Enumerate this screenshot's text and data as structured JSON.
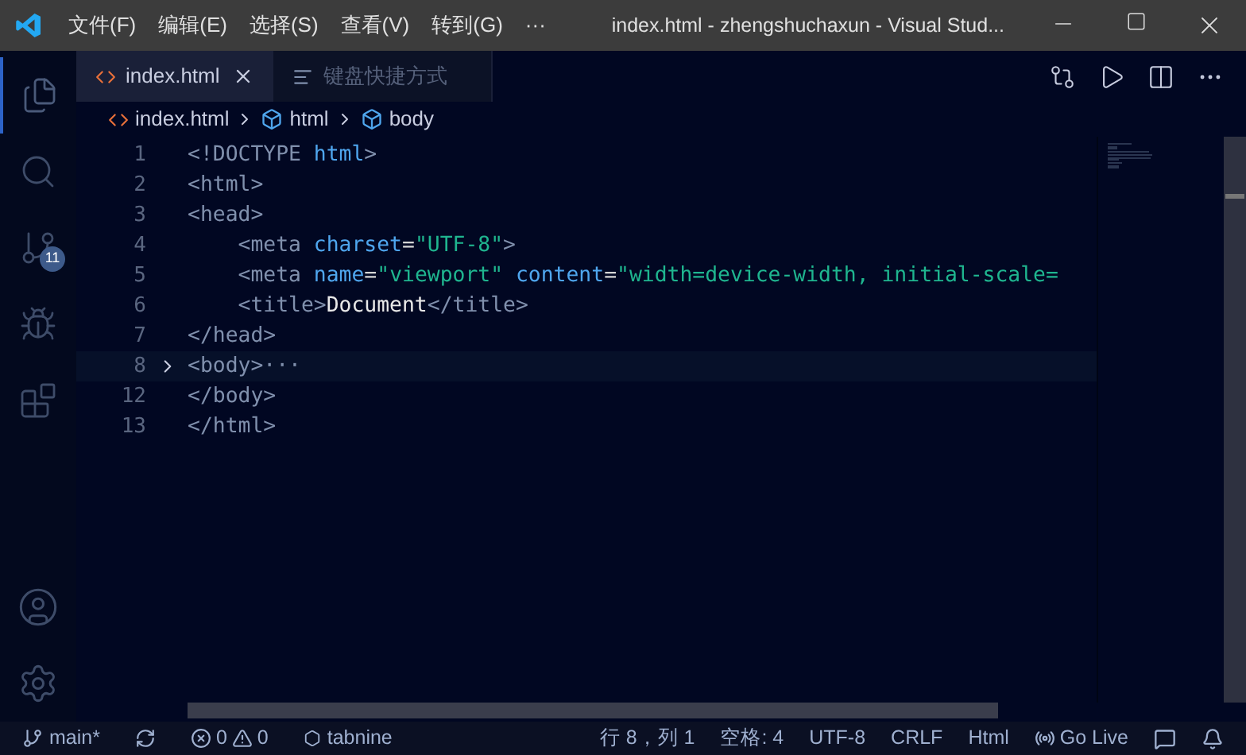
{
  "menu": [
    "文件(F)",
    "编辑(E)",
    "选择(S)",
    "查看(V)",
    "转到(G)",
    "···"
  ],
  "window": {
    "title": "index.html - zhengshuchaxun - Visual Stud..."
  },
  "activity_bar": [
    {
      "kind": "files",
      "selected": true
    },
    {
      "kind": "search",
      "selected": false
    },
    {
      "kind": "git",
      "selected": false,
      "badge": "11"
    },
    {
      "kind": "debug",
      "selected": false
    },
    {
      "kind": "extensions",
      "selected": false
    }
  ],
  "tabs": [
    {
      "label": "index.html",
      "kind": "html",
      "selected": true
    },
    {
      "label": "键盘快捷方式",
      "kind": "keys",
      "selected": false
    }
  ],
  "breadcrumbs": [
    {
      "label": "index.html",
      "kind": "file"
    },
    {
      "label": "html",
      "kind": "element"
    },
    {
      "label": "body",
      "kind": "element"
    }
  ],
  "code": [
    {
      "number": "1",
      "folded": false,
      "current": false,
      "tokens": [
        {
          "kind": "tag",
          "text": "<!DOCTYPE "
        },
        {
          "kind": "attr",
          "text": "html"
        },
        {
          "kind": "tag",
          "text": ">"
        }
      ]
    },
    {
      "number": "2",
      "folded": false,
      "current": false,
      "tokens": [
        {
          "kind": "tag",
          "text": "<html>"
        }
      ]
    },
    {
      "number": "3",
      "folded": false,
      "current": false,
      "tokens": [
        {
          "kind": "tag",
          "text": "<head>"
        }
      ]
    },
    {
      "number": "4",
      "folded": false,
      "current": false,
      "tokens": [
        {
          "kind": "tag",
          "text": "    <meta "
        },
        {
          "kind": "attr",
          "text": "charset"
        },
        {
          "kind": "punct",
          "text": "="
        },
        {
          "kind": "string",
          "text": "\"UTF-8\""
        },
        {
          "kind": "tag",
          "text": ">"
        }
      ]
    },
    {
      "number": "5",
      "folded": false,
      "current": false,
      "tokens": [
        {
          "kind": "tag",
          "text": "    <meta "
        },
        {
          "kind": "attr",
          "text": "name"
        },
        {
          "kind": "punct",
          "text": "="
        },
        {
          "kind": "string",
          "text": "\"viewport\""
        },
        {
          "kind": "attr",
          "text": " content"
        },
        {
          "kind": "punct",
          "text": "="
        },
        {
          "kind": "string",
          "text": "\"width=device-width, initial-scale="
        }
      ]
    },
    {
      "number": "6",
      "folded": false,
      "current": false,
      "tokens": [
        {
          "kind": "tag",
          "text": "    <title>"
        },
        {
          "kind": "text",
          "text": "Document"
        },
        {
          "kind": "tag",
          "text": "</title>"
        }
      ]
    },
    {
      "number": "7",
      "folded": false,
      "current": false,
      "tokens": [
        {
          "kind": "tag",
          "text": "</head>"
        }
      ]
    },
    {
      "number": "8",
      "folded": true,
      "current": true,
      "tokens": [
        {
          "kind": "tag",
          "text": "<body>"
        },
        {
          "kind": "ellipsis",
          "text": "···"
        }
      ]
    },
    {
      "number": "12",
      "folded": false,
      "current": false,
      "tokens": [
        {
          "kind": "tag",
          "text": "</body>"
        }
      ]
    },
    {
      "number": "13",
      "folded": false,
      "current": false,
      "tokens": [
        {
          "kind": "tag",
          "text": "</html>"
        }
      ]
    }
  ],
  "status_left": [
    {
      "kind": "branch",
      "text": "main*"
    },
    {
      "kind": "sync"
    },
    {
      "kind": "problems",
      "errors": "0",
      "warnings": "0"
    },
    {
      "kind": "tabnine",
      "text": "tabnine"
    }
  ],
  "status_right": [
    {
      "kind": "text",
      "text": "行 8，列 1"
    },
    {
      "kind": "text",
      "text": "空格: 4"
    },
    {
      "kind": "text",
      "text": "UTF-8"
    },
    {
      "kind": "text",
      "text": "CRLF"
    },
    {
      "kind": "text",
      "text": "Html"
    },
    {
      "kind": "golive",
      "text": "Go Live"
    },
    {
      "kind": "feedback"
    },
    {
      "kind": "bell"
    }
  ]
}
